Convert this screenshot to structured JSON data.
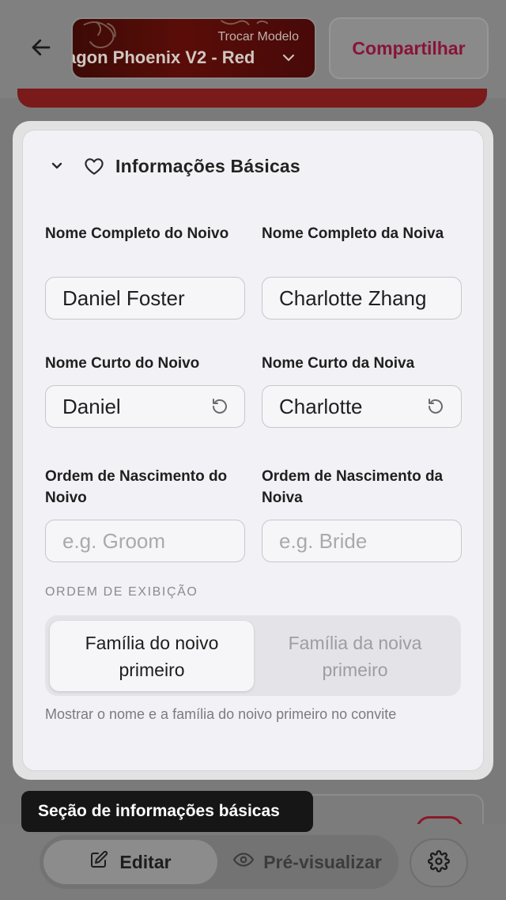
{
  "header": {
    "template_switch_label": "Trocar Modelo",
    "template_name": "agon Phoenix V2 - Red",
    "share_label": "Compartilhar"
  },
  "section": {
    "title": "Informações Básicas",
    "fields": {
      "groom_full_name": {
        "label": "Nome Completo do Noivo",
        "value": "Daniel Foster"
      },
      "bride_full_name": {
        "label": "Nome Completo da Noiva",
        "value": "Charlotte Zhang"
      },
      "groom_short_name": {
        "label": "Nome Curto do Noivo",
        "value": "Daniel"
      },
      "bride_short_name": {
        "label": "Nome Curto da Noiva",
        "value": "Charlotte"
      },
      "groom_birth_order": {
        "label": "Ordem de Nascimento do Noivo",
        "placeholder": "e.g. Groom"
      },
      "bride_birth_order": {
        "label": "Ordem de Nascimento da Noiva",
        "placeholder": "e.g. Bride"
      }
    },
    "display_order": {
      "label": "ORDEM DE EXIBIÇÃO",
      "options": [
        "Família do noivo primeiro",
        "Família da noiva primeiro"
      ],
      "selected": "Família do noivo primeiro",
      "hint": "Mostrar o nome e a família do noivo primeiro no convite"
    }
  },
  "toast": {
    "text": "Seção de informações básicas"
  },
  "bottom_nav": {
    "edit_label": "Editar",
    "preview_label": "Pré-visualizar",
    "active": "Editar"
  },
  "icons": {
    "back": "arrow-left-icon",
    "template_chevron": "chevron-down-icon",
    "section_chevron": "chevron-down-icon",
    "section": "heart-icon",
    "reset": "reset-icon",
    "edit": "pencil-square-icon",
    "preview": "eye-icon",
    "settings": "gear-icon"
  },
  "colors": {
    "accent": "#c2185b",
    "panel_bg": "#f2f1f6",
    "toast_bg": "#161616"
  }
}
